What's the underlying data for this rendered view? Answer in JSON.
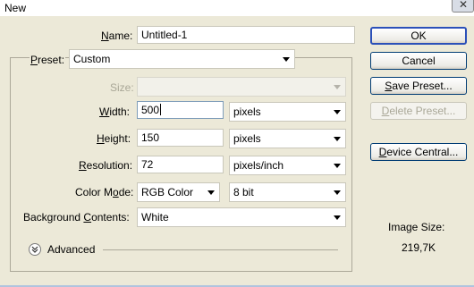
{
  "window": {
    "title": "New"
  },
  "name": {
    "label_u": "N",
    "label_rest": "ame:",
    "value": "Untitled-1"
  },
  "preset": {
    "label_u": "P",
    "label_rest": "reset:",
    "value": "Custom"
  },
  "size": {
    "label_u": "",
    "label_rest": "Size:",
    "value": ""
  },
  "width": {
    "label_u": "W",
    "label_rest": "idth:",
    "value": "500",
    "unit": "pixels"
  },
  "height": {
    "label_u": "H",
    "label_rest": "eight:",
    "value": "150",
    "unit": "pixels"
  },
  "resolution": {
    "label_u": "R",
    "label_rest": "esolution:",
    "value": "72",
    "unit": "pixels/inch"
  },
  "color_mode": {
    "label_pre": "Color M",
    "label_u": "o",
    "label_rest": "de:",
    "value": "RGB Color",
    "depth": "8 bit"
  },
  "background": {
    "label_pre": "Background ",
    "label_u": "C",
    "label_rest": "ontents:",
    "value": "White"
  },
  "advanced": {
    "label": "Advanced"
  },
  "buttons": {
    "ok": "OK",
    "cancel": "Cancel",
    "save_u": "S",
    "save_rest": "ave Preset...",
    "delete_u": "D",
    "delete_rest": "elete Preset...",
    "device_u": "D",
    "device_rest": "evice Central..."
  },
  "image_size": {
    "label": "Image Size:",
    "value": "219,7K"
  }
}
